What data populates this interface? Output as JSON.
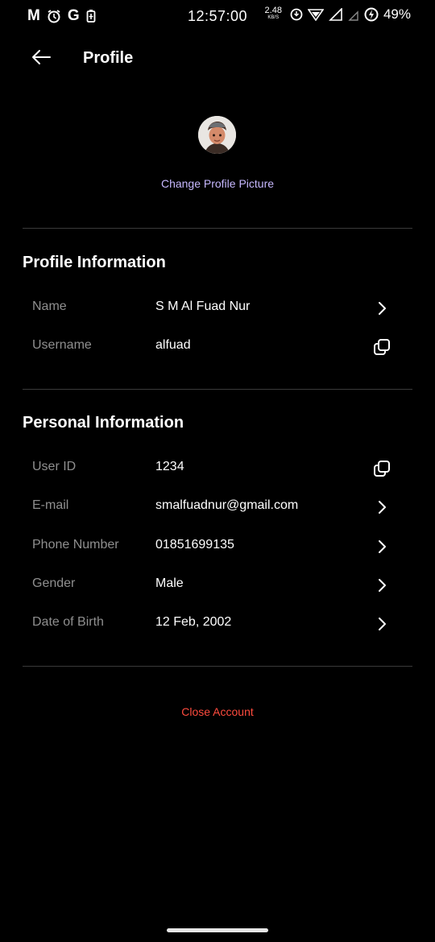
{
  "status_bar": {
    "left_icons": [
      "M",
      "G"
    ],
    "time": "12:57:00",
    "net_speed": "2.48",
    "net_unit": "KB/S",
    "battery": "49%"
  },
  "app_bar": {
    "title": "Profile"
  },
  "avatar": {
    "change_label": "Change Profile Picture"
  },
  "profile_section": {
    "title": "Profile Information",
    "rows": [
      {
        "label": "Name",
        "value": "S M Al Fuad Nur",
        "action_icon": "chevron-right-icon"
      },
      {
        "label": "Username",
        "value": "alfuad",
        "action_icon": "copy-icon"
      }
    ]
  },
  "personal_section": {
    "title": "Personal Information",
    "rows": [
      {
        "label": "User ID",
        "value": "1234",
        "action_icon": "copy-icon"
      },
      {
        "label": "E-mail",
        "value": "smalfuadnur@gmail.com",
        "action_icon": "chevron-right-icon"
      },
      {
        "label": "Phone Number",
        "value": "01851699135",
        "action_icon": "chevron-right-icon"
      },
      {
        "label": "Gender",
        "value": "Male",
        "action_icon": "chevron-right-icon"
      },
      {
        "label": "Date of Birth",
        "value": "12 Feb, 2002",
        "action_icon": "chevron-right-icon"
      }
    ]
  },
  "close_account": {
    "label": "Close Account"
  },
  "colors": {
    "accent_link": "#c7b8ff",
    "danger": "#ff4b3e",
    "label_gray": "#8f8f8f",
    "divider": "#3a3a3a"
  }
}
